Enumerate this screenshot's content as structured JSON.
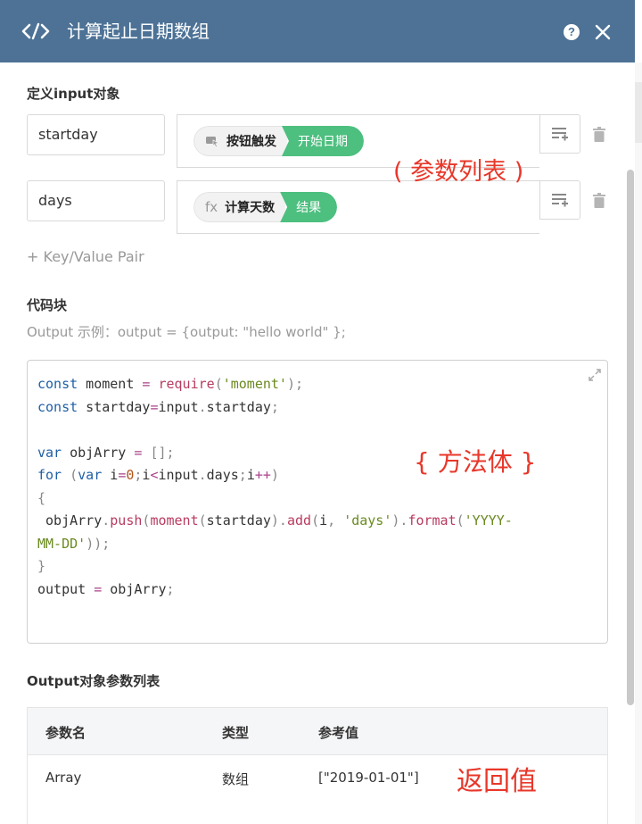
{
  "header": {
    "title": "计算起止日期数组",
    "help_label": "?"
  },
  "input_section": {
    "label": "定义input对象",
    "rows": [
      {
        "key": "startday",
        "source": "按钮触发",
        "field": "开始日期",
        "icon": "trigger-icon"
      },
      {
        "key": "days",
        "source": "计算天数",
        "field": "结果",
        "icon": "fx-icon",
        "icon_text": "fx"
      }
    ],
    "add_pair": "+ Key/Value Pair"
  },
  "code_section": {
    "label": "代码块",
    "hint": "Output 示例：output = {output: \"hello world\" };"
  },
  "output_section": {
    "label": "Output对象参数列表",
    "columns": [
      "参数名",
      "类型",
      "参考值"
    ],
    "rows": [
      {
        "name": "Array",
        "type": "数组",
        "sample": "[\"2019-01-01\"]"
      }
    ]
  },
  "annotations": {
    "params": "( 参数列表 )",
    "body": "{ 方法体 }",
    "return": "返回值"
  },
  "colors": {
    "header_bg": "#4d7296",
    "pill_green": "#4dbf7f",
    "annotation_red": "#e8372a"
  }
}
